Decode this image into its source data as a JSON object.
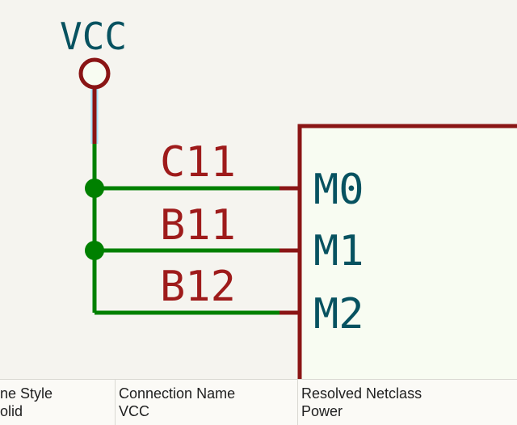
{
  "colors": {
    "background": "#f5f4ef",
    "component_fill": "#f8fcf2",
    "component_stroke": "#8a1515",
    "wire": "#008000",
    "schematic_text": "#075260",
    "selection_highlight": "#a6e1ff"
  },
  "power_port": {
    "label": "VCC"
  },
  "component": {
    "pins": [
      {
        "number": "C11",
        "name": "M0"
      },
      {
        "number": "B11",
        "name": "M1"
      },
      {
        "number": "B12",
        "name": "M2"
      }
    ]
  },
  "net": {
    "junction_count": 2,
    "selected_segment": "vcc-stub"
  },
  "status_bar": {
    "col0": {
      "header": "ne Style",
      "value": "olid"
    },
    "col1": {
      "header": "Connection Name",
      "value": "VCC"
    },
    "col2": {
      "header": "Resolved Netclass",
      "value": "Power"
    }
  }
}
